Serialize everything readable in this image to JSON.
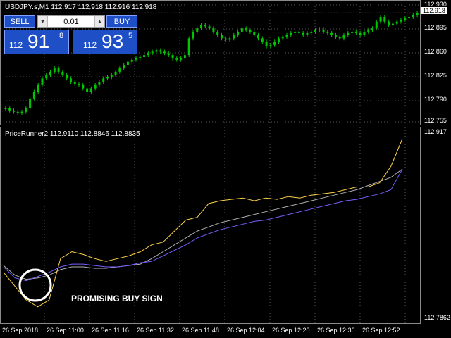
{
  "main": {
    "title": "USDJPY.s,M1  112.917 112.918 112.916 112.918",
    "price_labels": [
      "112.930",
      "112.895",
      "112.860",
      "112.825",
      "112.790",
      "112.755"
    ],
    "current_price": "112.918",
    "candle_color": "#00c800",
    "candles": [
      112.775,
      112.772,
      112.77,
      112.768,
      112.77,
      112.775,
      112.79,
      112.8,
      112.81,
      112.82,
      112.825,
      112.83,
      112.835,
      112.83,
      112.825,
      112.82,
      112.815,
      112.812,
      112.81,
      112.805,
      112.8,
      112.805,
      112.81,
      112.815,
      112.82,
      112.822,
      112.825,
      112.83,
      112.835,
      112.84,
      112.845,
      112.848,
      112.85,
      112.852,
      112.855,
      112.858,
      112.86,
      112.862,
      112.86,
      112.858,
      112.855,
      112.85,
      112.848,
      112.85,
      112.855,
      112.88,
      112.89,
      112.895,
      112.9,
      112.898,
      112.895,
      112.89,
      112.885,
      112.88,
      112.878,
      112.88,
      112.885,
      112.89,
      112.895,
      112.892,
      112.89,
      112.885,
      112.88,
      112.875,
      112.868,
      112.87,
      112.875,
      112.88,
      112.882,
      112.885,
      112.888,
      112.89,
      112.888,
      112.885,
      112.888,
      112.89,
      112.892,
      112.893,
      112.89,
      112.888,
      112.885,
      112.882,
      112.88,
      112.885,
      112.888,
      112.89,
      112.888,
      112.885,
      112.89,
      112.892,
      112.895,
      112.905,
      112.912,
      112.905,
      112.9,
      112.902,
      112.905,
      112.908,
      112.91,
      112.912,
      112.915,
      112.918
    ]
  },
  "indicator": {
    "title": "PriceRunner2  112.9110 112.8846 112.8835",
    "top_label": "112.917",
    "bottom_label": "112.7862",
    "line_colors": [
      "#ffd24a",
      "#b0b0b0",
      "#7a5cff"
    ],
    "ylim": [
      112.7862,
      112.917
    ],
    "yellow": [
      112.82,
      112.81,
      112.8,
      112.795,
      112.8,
      112.83,
      112.835,
      112.833,
      112.83,
      112.828,
      112.83,
      112.832,
      112.835,
      112.84,
      112.842,
      112.85,
      112.858,
      112.86,
      112.87,
      112.872,
      112.873,
      112.874,
      112.872,
      112.874,
      112.873,
      112.875,
      112.874,
      112.876,
      112.877,
      112.878,
      112.88,
      112.882,
      112.882,
      112.885,
      112.897,
      112.917
    ],
    "gray": [
      112.825,
      112.818,
      112.815,
      112.816,
      112.818,
      112.822,
      112.824,
      112.824,
      112.823,
      112.823,
      112.824,
      112.825,
      112.826,
      112.83,
      112.835,
      112.84,
      112.845,
      112.85,
      112.853,
      112.856,
      112.858,
      112.86,
      112.862,
      112.864,
      112.866,
      112.868,
      112.87,
      112.872,
      112.874,
      112.876,
      112.878,
      112.88,
      112.883,
      112.886,
      112.889,
      112.895
    ],
    "purple": [
      112.824,
      112.816,
      112.814,
      112.817,
      112.82,
      112.824,
      112.826,
      112.826,
      112.825,
      112.824,
      112.824,
      112.825,
      112.827,
      112.828,
      112.832,
      112.836,
      112.84,
      112.845,
      112.848,
      112.851,
      112.853,
      112.855,
      112.857,
      112.858,
      112.86,
      112.862,
      112.864,
      112.866,
      112.868,
      112.87,
      112.872,
      112.873,
      112.875,
      112.877,
      112.88,
      112.895
    ],
    "annotation": "PROMISING BUY SIGN"
  },
  "time_labels": [
    "26 Sep 2018",
    "26 Sep 11:00",
    "26 Sep 11:16",
    "26 Sep 11:32",
    "26 Sep 11:48",
    "26 Sep 12:04",
    "26 Sep 12:20",
    "26 Sep 12:36",
    "26 Sep 12:52"
  ],
  "trade_panel": {
    "sell_label": "SELL",
    "buy_label": "BUY",
    "lot_value": "0.01",
    "sell_prefix": "112",
    "sell_big": "91",
    "sell_sup": "8",
    "buy_prefix": "112",
    "buy_big": "93",
    "buy_sup": "5"
  }
}
